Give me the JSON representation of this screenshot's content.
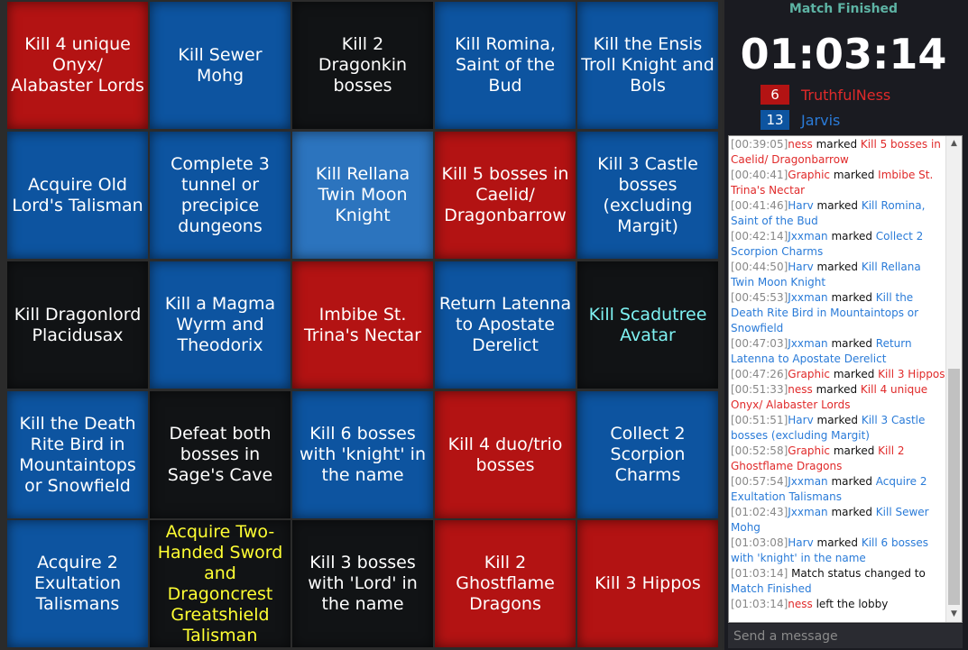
{
  "board": {
    "cells": [
      {
        "label": "Kill 4 unique Onyx/ Alabaster Lords",
        "color": "red",
        "text_color": "white"
      },
      {
        "label": "Kill Sewer Mohg",
        "color": "blue",
        "text_color": "white"
      },
      {
        "label": "Kill 2 Dragonkin bosses",
        "color": "black",
        "text_color": "white"
      },
      {
        "label": "Kill Romina, Saint of the Bud",
        "color": "blue",
        "text_color": "white"
      },
      {
        "label": "Kill the Ensis Troll Knight and Bols",
        "color": "blue",
        "text_color": "white"
      },
      {
        "label": "Acquire Old Lord's Talisman",
        "color": "blue",
        "text_color": "white"
      },
      {
        "label": "Complete 3 tunnel or precipice dungeons",
        "color": "blue",
        "text_color": "white"
      },
      {
        "label": "Kill Rellana Twin Moon Knight",
        "color": "lightblue",
        "text_color": "white"
      },
      {
        "label": "Kill 5 bosses in Caelid/ Dragonbarrow",
        "color": "red",
        "text_color": "white"
      },
      {
        "label": "Kill 3 Castle bosses (excluding Margit)",
        "color": "blue",
        "text_color": "white"
      },
      {
        "label": "Kill Dragonlord Placidusax",
        "color": "black",
        "text_color": "white"
      },
      {
        "label": "Kill a Magma Wyrm and Theodorix",
        "color": "blue",
        "text_color": "white"
      },
      {
        "label": "Imbibe St. Trina's Nectar",
        "color": "red",
        "text_color": "white"
      },
      {
        "label": "Return Latenna to Apostate Derelict",
        "color": "blue",
        "text_color": "white"
      },
      {
        "label": "Kill Scadutree Avatar",
        "color": "black",
        "text_color": "cyan"
      },
      {
        "label": "Kill the Death Rite Bird in Mountaintops or Snowfield",
        "color": "blue",
        "text_color": "white"
      },
      {
        "label": "Defeat both bosses in Sage's Cave",
        "color": "black",
        "text_color": "white"
      },
      {
        "label": "Kill 6 bosses with 'knight' in the name",
        "color": "blue",
        "text_color": "white"
      },
      {
        "label": "Kill 4 duo/trio bosses",
        "color": "red",
        "text_color": "white"
      },
      {
        "label": "Collect 2 Scorpion Charms",
        "color": "blue",
        "text_color": "white"
      },
      {
        "label": "Acquire 2 Exultation Talismans",
        "color": "blue",
        "text_color": "white"
      },
      {
        "label": "Acquire Two-Handed Sword and Dragoncrest Greatshield Talisman",
        "color": "black",
        "text_color": "yellow"
      },
      {
        "label": "Kill 3 bosses with 'Lord' in the name",
        "color": "black",
        "text_color": "white"
      },
      {
        "label": "Kill 2 Ghostflame Dragons",
        "color": "red",
        "text_color": "white"
      },
      {
        "label": "Kill 3 Hippos",
        "color": "red",
        "text_color": "white"
      }
    ]
  },
  "sidebar": {
    "status": "Match Finished",
    "timer": "01:03:14",
    "players": [
      {
        "score": "6",
        "name": "TruthfulNess",
        "color": "#e02a2a",
        "box_color": "#b31313"
      },
      {
        "score": "13",
        "name": "Jarvis",
        "color": "#2a7bd8",
        "box_color": "#0d54a0"
      }
    ],
    "message_placeholder": "Send a message"
  },
  "chat": [
    {
      "time": "[00:39:05]",
      "parts": [
        {
          "t": "ness",
          "c": "red-t"
        },
        {
          "t": " marked ",
          "c": ""
        },
        {
          "t": "Kill 5 bosses in Caelid/ Dragonbarrow",
          "c": "red-t"
        }
      ]
    },
    {
      "time": "[00:40:41]",
      "parts": [
        {
          "t": "Graphic",
          "c": "red-t"
        },
        {
          "t": " marked ",
          "c": ""
        },
        {
          "t": "Imbibe St. Trina's Nectar",
          "c": "red-t"
        }
      ]
    },
    {
      "time": "[00:41:46]",
      "parts": [
        {
          "t": "Harv",
          "c": "blue-t"
        },
        {
          "t": " marked ",
          "c": ""
        },
        {
          "t": "Kill Romina, Saint of the Bud",
          "c": "blue-t"
        }
      ]
    },
    {
      "time": "[00:42:14]",
      "parts": [
        {
          "t": "Jxxman",
          "c": "blue-t"
        },
        {
          "t": " marked ",
          "c": ""
        },
        {
          "t": "Collect 2 Scorpion Charms",
          "c": "blue-t"
        }
      ]
    },
    {
      "time": "[00:44:50]",
      "parts": [
        {
          "t": "Harv",
          "c": "blue-t"
        },
        {
          "t": " marked ",
          "c": ""
        },
        {
          "t": "Kill Rellana Twin Moon Knight",
          "c": "blue-t"
        }
      ]
    },
    {
      "time": "[00:45:53]",
      "parts": [
        {
          "t": "Jxxman",
          "c": "blue-t"
        },
        {
          "t": " marked ",
          "c": ""
        },
        {
          "t": "Kill the Death Rite Bird in Mountaintops or Snowfield",
          "c": "blue-t"
        }
      ]
    },
    {
      "time": "[00:47:03]",
      "parts": [
        {
          "t": "Jxxman",
          "c": "blue-t"
        },
        {
          "t": " marked ",
          "c": ""
        },
        {
          "t": "Return Latenna to Apostate Derelict",
          "c": "blue-t"
        }
      ]
    },
    {
      "time": "[00:47:26]",
      "parts": [
        {
          "t": "Graphic",
          "c": "red-t"
        },
        {
          "t": " marked ",
          "c": ""
        },
        {
          "t": "Kill 3 Hippos",
          "c": "red-t"
        }
      ]
    },
    {
      "time": "[00:51:33]",
      "parts": [
        {
          "t": "ness",
          "c": "red-t"
        },
        {
          "t": " marked ",
          "c": ""
        },
        {
          "t": "Kill 4 unique Onyx/ Alabaster Lords",
          "c": "red-t"
        }
      ]
    },
    {
      "time": "[00:51:51]",
      "parts": [
        {
          "t": "Harv",
          "c": "blue-t"
        },
        {
          "t": " marked ",
          "c": ""
        },
        {
          "t": "Kill 3 Castle bosses (excluding Margit)",
          "c": "blue-t"
        }
      ]
    },
    {
      "time": "[00:52:58]",
      "parts": [
        {
          "t": "Graphic",
          "c": "red-t"
        },
        {
          "t": " marked ",
          "c": ""
        },
        {
          "t": "Kill 2 Ghostflame Dragons",
          "c": "red-t"
        }
      ]
    },
    {
      "time": "[00:57:54]",
      "parts": [
        {
          "t": "Jxxman",
          "c": "blue-t"
        },
        {
          "t": " marked ",
          "c": ""
        },
        {
          "t": "Acquire 2 Exultation Talismans",
          "c": "blue-t"
        }
      ]
    },
    {
      "time": "[01:02:43]",
      "parts": [
        {
          "t": "Jxxman",
          "c": "blue-t"
        },
        {
          "t": " marked ",
          "c": ""
        },
        {
          "t": "Kill Sewer Mohg",
          "c": "blue-t"
        }
      ]
    },
    {
      "time": "[01:03:08]",
      "parts": [
        {
          "t": "Harv",
          "c": "blue-t"
        },
        {
          "t": " marked ",
          "c": ""
        },
        {
          "t": "Kill 6 bosses with 'knight' in the name",
          "c": "blue-t"
        }
      ]
    },
    {
      "time": "[01:03:14]",
      "parts": [
        {
          "t": " Match status changed to ",
          "c": ""
        },
        {
          "t": "Match Finished",
          "c": "blue-t"
        }
      ]
    },
    {
      "time": "[01:03:14]",
      "parts": [
        {
          "t": "ness",
          "c": "red-t"
        },
        {
          "t": " left the lobby",
          "c": ""
        }
      ]
    }
  ]
}
